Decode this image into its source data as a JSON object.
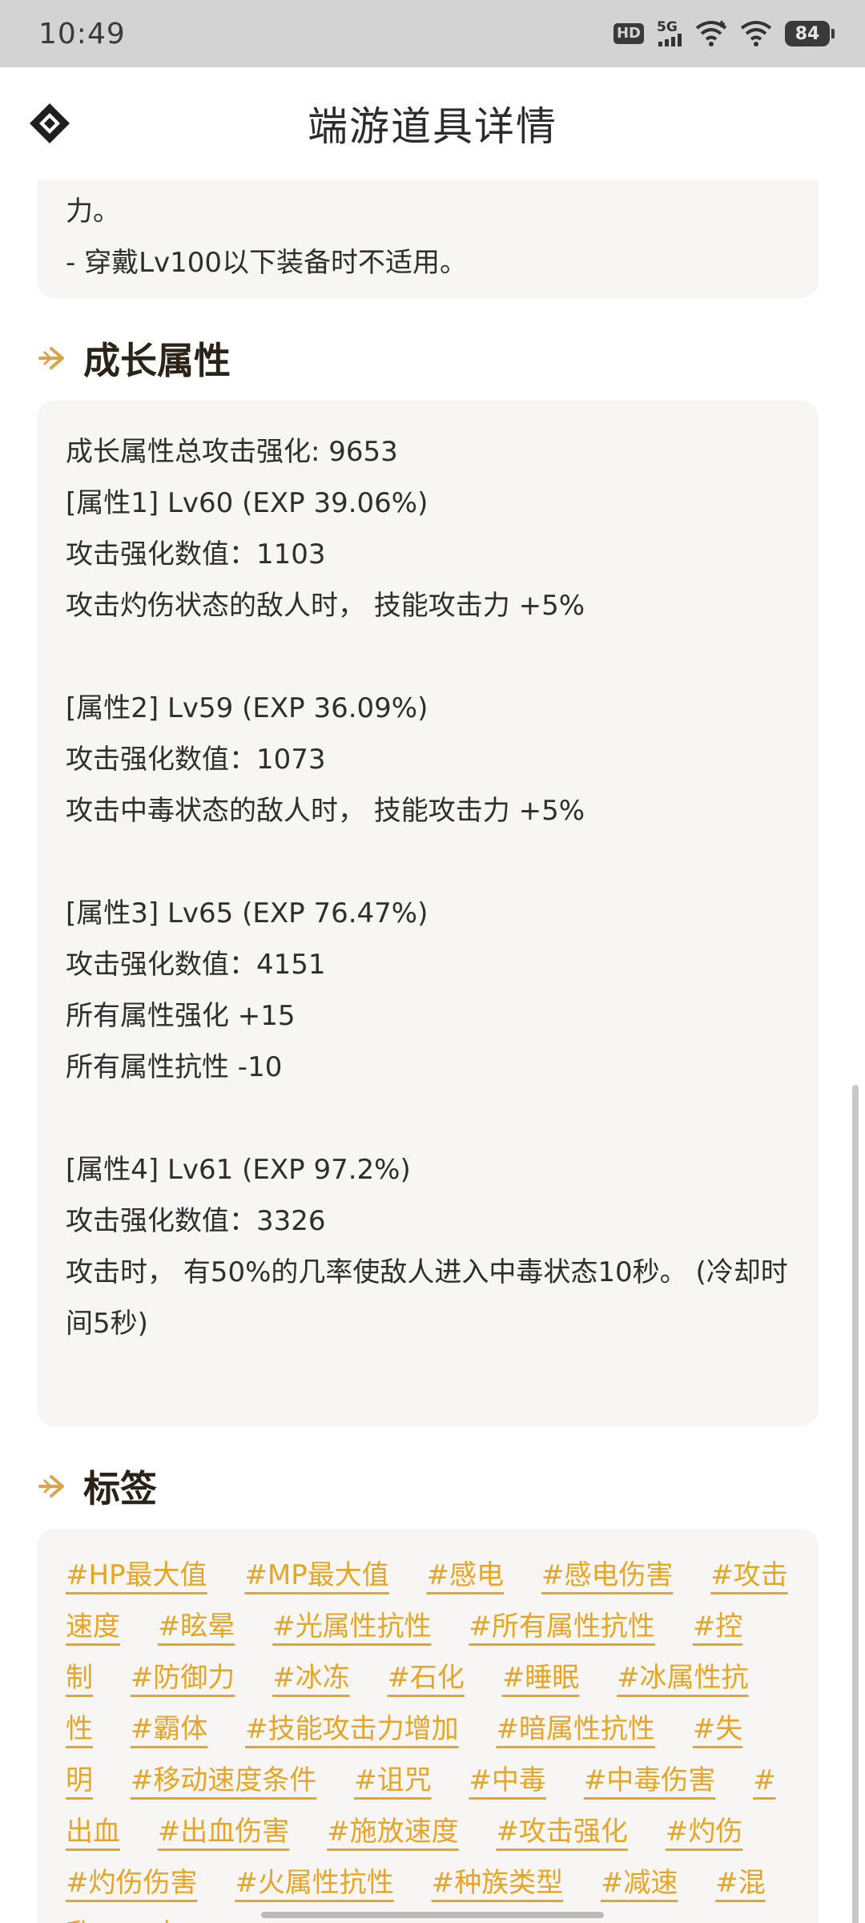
{
  "status_bar": {
    "time": "10:49",
    "hd": "HD",
    "network": "5G",
    "battery": "84"
  },
  "header": {
    "title": "端游道具详情"
  },
  "intro_card": {
    "lines": [
      "力。",
      "- 穿戴Lv100以下装备时不适用。"
    ]
  },
  "growth": {
    "title": "成长属性",
    "total": "成长属性总攻击强化: 9653",
    "attr1": {
      "head": "[属性1] Lv60 (EXP 39.06%)",
      "value": "攻击强化数值：1103",
      "effect": "攻击灼伤状态的敌人时， 技能攻击力 +5%"
    },
    "attr2": {
      "head": "[属性2] Lv59 (EXP 36.09%)",
      "value": "攻击强化数值：1073",
      "effect": "攻击中毒状态的敌人时， 技能攻击力 +5%"
    },
    "attr3": {
      "head": "[属性3] Lv65 (EXP 76.47%)",
      "value": "攻击强化数值：4151",
      "effect1": "所有属性强化 +15",
      "effect2": "所有属性抗性 -10"
    },
    "attr4": {
      "head": "[属性4] Lv61 (EXP 97.2%)",
      "value": "攻击强化数值：3326",
      "effect": "攻击时， 有50%的几率使敌人进入中毒状态10秒。 (冷却时间5秒)"
    }
  },
  "tags": {
    "title": "标签",
    "items": [
      "#HP最大值",
      "#MP最大值",
      "#感电",
      "#感电伤害",
      "#攻击速度",
      "#眩晕",
      "#光属性抗性",
      "#所有属性抗性",
      "#控制",
      "#防御力",
      "#冰冻",
      "#石化",
      "#睡眠",
      "#冰属性抗性",
      "#霸体",
      "#技能攻击力增加",
      "#暗属性抗性",
      "#失明",
      "#移动速度条件",
      "#诅咒",
      "#中毒",
      "#中毒伤害",
      "#出血",
      "#出血伤害",
      "#施放速度",
      "#攻击强化",
      "#灼伤",
      "#灼伤伤害",
      "#火属性抗性",
      "#种族类型",
      "#减速",
      "#混乱",
      "#束"
    ],
    "color": "#e8a524"
  }
}
